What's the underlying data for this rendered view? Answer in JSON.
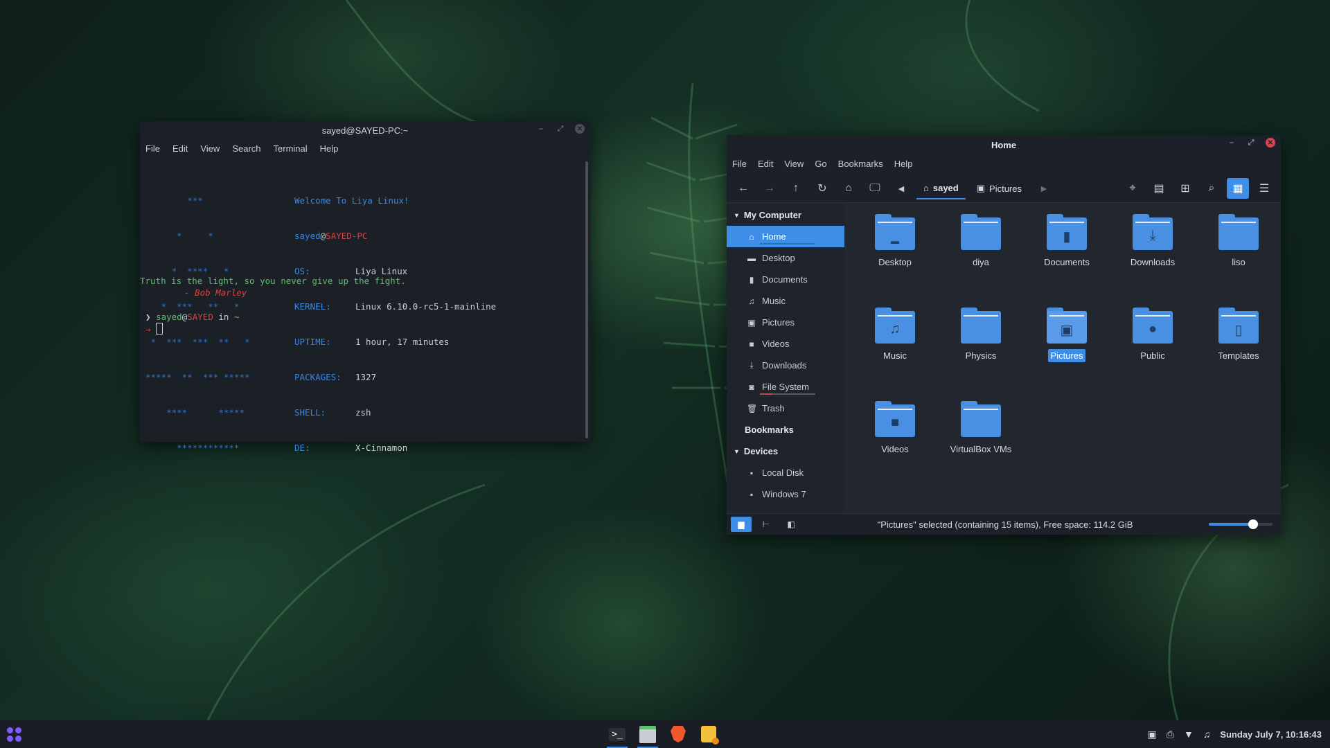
{
  "terminal": {
    "title": "sayed@SAYED-PC:~",
    "menu": [
      "File",
      "Edit",
      "View",
      "Search",
      "Terminal",
      "Help"
    ],
    "logo": [
      "        ***",
      "      *     *",
      "     *  ****   *",
      "   *  ***   **   *",
      " *  ***  ***  **   *",
      "*****  **  *** *****",
      "    ****      *****",
      "      ************"
    ],
    "welcome": "Welcome To Liya Linux!",
    "user": "sayed",
    "at": "@",
    "host": "SAYED-PC",
    "info": [
      {
        "key": "OS:",
        "value": "Liya Linux"
      },
      {
        "key": "KERNEL:",
        "value": "Linux 6.10.0-rc5-1-mainline"
      },
      {
        "key": "UPTIME:",
        "value": "1 hour, 17 minutes"
      },
      {
        "key": "PACKAGES:",
        "value": "1327"
      },
      {
        "key": "SHELL:",
        "value": "zsh"
      },
      {
        "key": "DE:",
        "value": "X-Cinnamon"
      }
    ],
    "quote": "Truth is the light, so you never give up the fight.",
    "quote_author": "- Bob Marley",
    "prompt_symbol": "❯",
    "prompt_user": "sayed",
    "prompt_at": "@",
    "prompt_host": "SAYED",
    "prompt_in": "in",
    "prompt_dir": "~",
    "prompt_arrow": "→"
  },
  "filemanager": {
    "title": "Home",
    "menu": [
      "File",
      "Edit",
      "View",
      "Go",
      "Bookmarks",
      "Help"
    ],
    "breadcrumb": [
      "sayed",
      "Pictures"
    ],
    "sidebar": {
      "my_computer": "My Computer",
      "places": [
        "Home",
        "Desktop",
        "Documents",
        "Music",
        "Pictures",
        "Videos",
        "Downloads",
        "File System",
        "Trash"
      ],
      "bookmarks": "Bookmarks",
      "devices": "Devices",
      "device_items": [
        "Local Disk",
        "Windows 7"
      ]
    },
    "folders": [
      "Desktop",
      "diya",
      "Documents",
      "Downloads",
      "liso",
      "Music",
      "Physics",
      "Pictures",
      "Public",
      "Templates",
      "Videos",
      "VirtualBox VMs"
    ],
    "selected_folder": "Pictures",
    "status": "\"Pictures\" selected (containing 15 items), Free space: 114.2 GiB",
    "zoom_fraction": 0.7
  },
  "taskbar": {
    "clock": "Sunday July 7, 10:16:43",
    "apps": [
      "terminal-icon",
      "files-icon",
      "brave-icon",
      "notes-icon"
    ]
  }
}
